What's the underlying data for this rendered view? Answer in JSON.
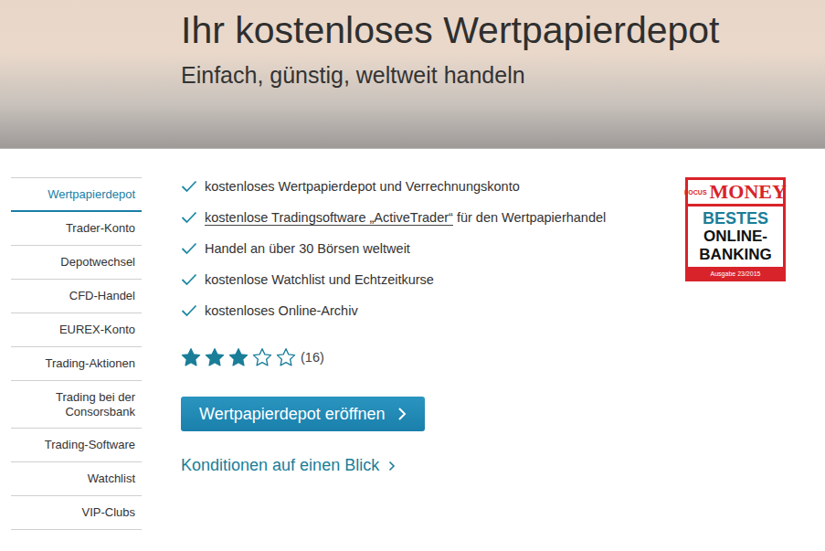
{
  "hero": {
    "title": "Ihr kostenloses Wertpapierdepot",
    "subtitle": "Einfach, günstig, weltweit handeln"
  },
  "sidebar": {
    "items": [
      {
        "label": "Wertpapierdepot",
        "selected": true
      },
      {
        "label": "Trader-Konto",
        "selected": false
      },
      {
        "label": "Depotwechsel",
        "selected": false
      },
      {
        "label": "CFD-Handel",
        "selected": false
      },
      {
        "label": "EUREX-Konto",
        "selected": false
      },
      {
        "label": "Trading-Aktionen",
        "selected": false
      },
      {
        "label": "Trading bei der Consorsbank",
        "selected": false
      },
      {
        "label": "Trading-Software",
        "selected": false
      },
      {
        "label": "Watchlist",
        "selected": false
      },
      {
        "label": "VIP-Clubs",
        "selected": false
      }
    ]
  },
  "features": [
    {
      "parts": [
        {
          "text": "kostenloses Wertpapierdepot und Verrechnungskonto",
          "link": false
        }
      ]
    },
    {
      "parts": [
        {
          "text": "kostenlose Tradingsoftware „ActiveTrader“",
          "link": true
        },
        {
          "text": " für den Wertpapierhandel",
          "link": false
        }
      ]
    },
    {
      "parts": [
        {
          "text": "Handel an über 30 Börsen weltweit",
          "link": false
        }
      ]
    },
    {
      "parts": [
        {
          "text": "kostenlose Watchlist und Echtzeitkurse",
          "link": false
        }
      ]
    },
    {
      "parts": [
        {
          "text": "kostenloses Online-Archiv",
          "link": false
        }
      ]
    }
  ],
  "rating": {
    "stars": 3,
    "max": 5,
    "count": "(16)"
  },
  "cta": {
    "label": "Wertpapierdepot eröffnen"
  },
  "conditions_link": {
    "label": "Konditionen auf einen Blick"
  },
  "badge": {
    "brand_small": "FOCUS",
    "brand": "MONEY",
    "lines": [
      "BESTES",
      "ONLINE-",
      "BANKING"
    ],
    "issue": "Ausgabe 23/2015"
  }
}
